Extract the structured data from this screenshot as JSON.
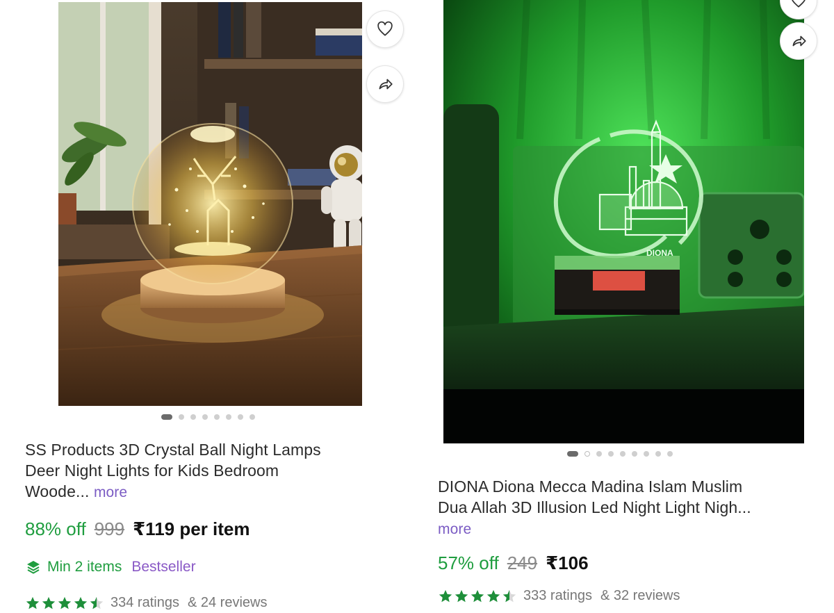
{
  "products": [
    {
      "title_line1": "SS Products 3D Crystal Ball Night Lamps",
      "title_line2": "Deer Night Lights for Kids Bedroom",
      "title_line3": "Woode...",
      "more_label": "more",
      "discount": "88% off",
      "mrp": "999",
      "price": "₹119 per item",
      "min_items": "Min 2 items",
      "badge": "Bestseller",
      "rating_value": 4.5,
      "ratings_count": "334 ratings",
      "reviews_count": "& 24 reviews",
      "image_dots": 8,
      "active_dot": 0
    },
    {
      "title_line1": "DIONA Diona Mecca Madina Islam Muslim",
      "title_line2": "Dua Allah 3D Illusion Led Night Light Nigh...",
      "more_label": "more",
      "discount": "57% off",
      "mrp": "249",
      "price": "₹106",
      "rating_value": 4.5,
      "ratings_count": "333 ratings",
      "reviews_count": "& 32 reviews",
      "image_dots": 9,
      "active_dot": 0,
      "brand_on_lamp": "DIONA"
    }
  ],
  "icons": {
    "wishlist": "heart-icon",
    "share": "share-icon",
    "min_items": "layers-icon",
    "star": "star-icon"
  },
  "colors": {
    "discount_green": "#1f9d3f",
    "badge_purple": "#8a59c6",
    "more_purple": "#7b5cc4",
    "star_green": "#1e8f3a"
  }
}
